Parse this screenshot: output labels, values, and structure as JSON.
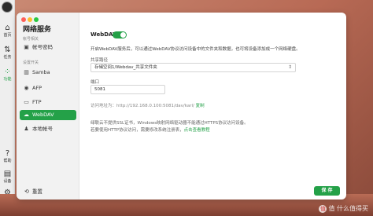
{
  "rail": {
    "items": [
      {
        "label": "首页",
        "icon": "home-icon"
      },
      {
        "label": "任务",
        "icon": "task-icon"
      },
      {
        "label": "功能",
        "icon": "apps-icon",
        "active": true
      },
      {
        "label": "帮助",
        "icon": "help-icon"
      },
      {
        "label": "设备",
        "icon": "device-icon"
      },
      {
        "label": "设置",
        "icon": "settings-icon"
      }
    ]
  },
  "sidebar": {
    "title": "网络服务",
    "section_account": "帐号相关",
    "section_protocol": "设置开关",
    "items": [
      {
        "label": "帐号密码",
        "icon": "lock-icon"
      },
      {
        "label": "Samba",
        "icon": "samba-icon"
      },
      {
        "label": "AFP",
        "icon": "afp-icon"
      },
      {
        "label": "FTP",
        "icon": "ftp-icon"
      },
      {
        "label": "WebDAV",
        "icon": "cloud-icon",
        "active": true
      },
      {
        "label": "本地帐号",
        "icon": "user-icon"
      }
    ],
    "reset_label": "重置"
  },
  "main": {
    "webdav_label": "WebDAV",
    "webdav_enabled": true,
    "description": "开启WebDAV服务后，可以通过WebDAV协议访问设备中的文件夹和数据，也可将设备添加成一个网络硬盘。",
    "share_path_label": "共享路径",
    "share_path_value": "存储空间1/Webdav_共享文件夹",
    "port_label": "端口",
    "port_value": "5081",
    "access_prefix": "访问地址为：",
    "access_url": "http://192.168.0.100:5081/dav/karl/",
    "copy_label": "复制",
    "note_line1": "绿联云不提供SSL证书，Windows映射网络驱动器不能通过HTTPS协议访问设备。",
    "note_line2": "若要使用HTTP协议访问，需要修改系统注册表，",
    "note_link": "点击查看教程",
    "save_label": "保 存"
  },
  "watermark": "值 什么值得买"
}
